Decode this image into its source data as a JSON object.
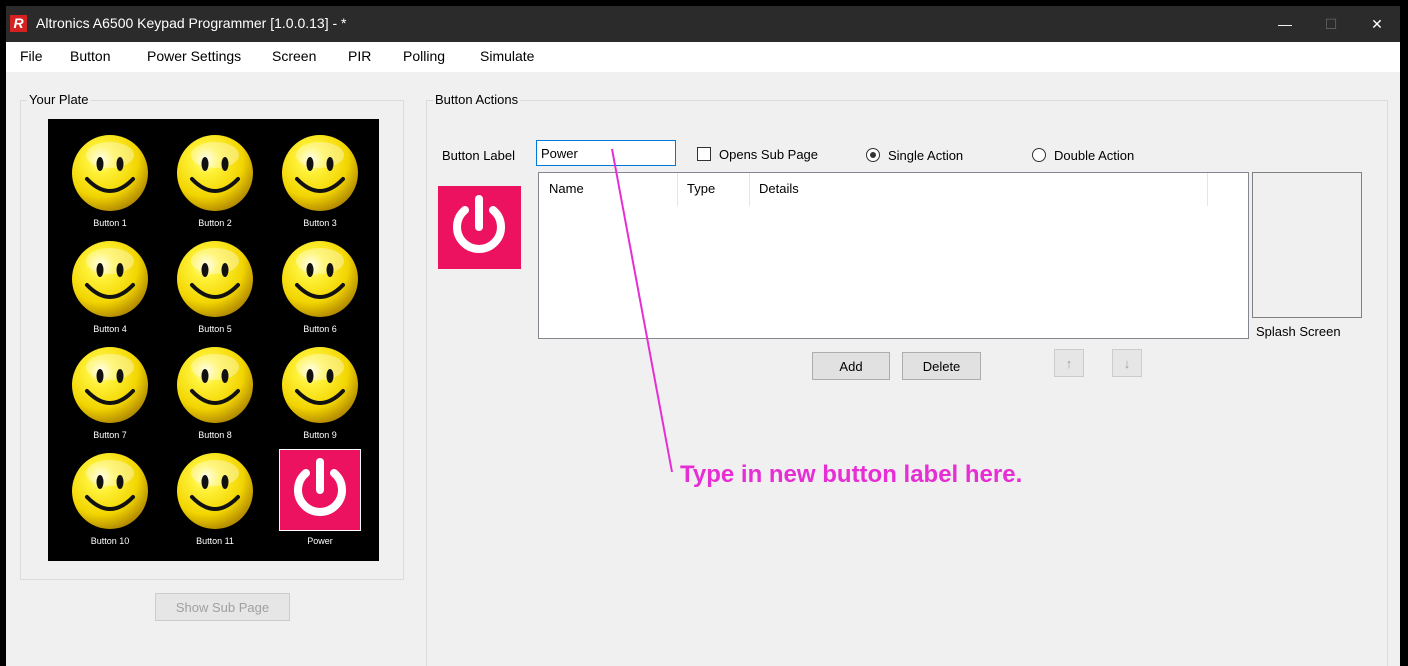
{
  "window": {
    "title": "Altronics A6500 Keypad Programmer [1.0.0.13]  - *",
    "app_icon": "R",
    "controls": {
      "minimize": "—",
      "maximize": "☐",
      "close": "✕"
    }
  },
  "menu": [
    "File",
    "Button",
    "Power Settings",
    "Screen",
    "PIR",
    "Polling",
    "Simulate"
  ],
  "plate": {
    "legend": "Your Plate",
    "buttons": [
      "Button 1",
      "Button 2",
      "Button 3",
      "Button 4",
      "Button 5",
      "Button 6",
      "Button 7",
      "Button 8",
      "Button 9",
      "Button 10",
      "Button 11",
      "Power"
    ],
    "show_sub_page": "Show Sub Page"
  },
  "actions": {
    "legend": "Button Actions",
    "button_label_caption": "Button Label",
    "button_label_value": "Power",
    "opens_sub_page": {
      "label": "Opens Sub Page",
      "checked": false
    },
    "single_action": {
      "label": "Single Action",
      "selected": true
    },
    "double_action": {
      "label": "Double Action",
      "selected": false
    },
    "columns": [
      "Name",
      "Type",
      "Details"
    ],
    "add": "Add",
    "delete": "Delete",
    "up_arrow": "↑",
    "down_arrow": "↓",
    "splash_screen": "Splash Screen"
  },
  "annotation": {
    "text": "Type in new button label here."
  },
  "colors": {
    "power_tile": "#ec1260",
    "callout": "#e62ed4",
    "titlebar": "#2b2b2b"
  }
}
